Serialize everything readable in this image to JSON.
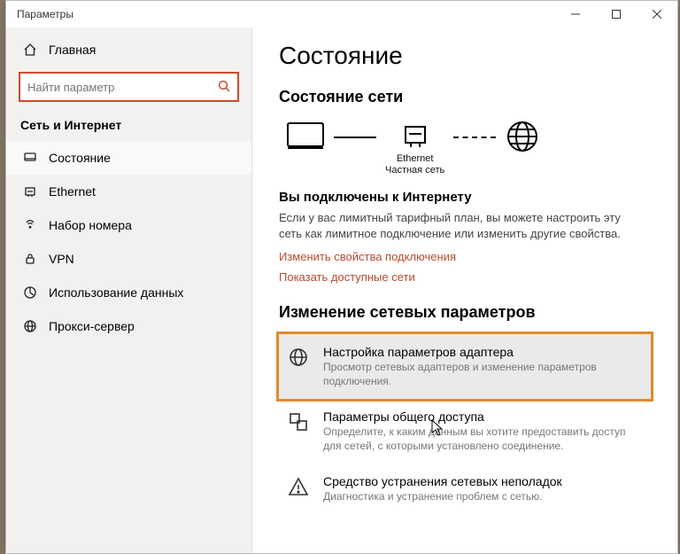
{
  "titlebar": {
    "title": "Параметры"
  },
  "sidebar": {
    "home": "Главная",
    "search_placeholder": "Найти параметр",
    "group": "Сеть и Интернет",
    "items": [
      {
        "label": "Состояние"
      },
      {
        "label": "Ethernet"
      },
      {
        "label": "Набор номера"
      },
      {
        "label": "VPN"
      },
      {
        "label": "Использование данных"
      },
      {
        "label": "Прокси-сервер"
      }
    ]
  },
  "main": {
    "heading": "Состояние",
    "net_status_title": "Состояние сети",
    "diagram": {
      "iface": "Ethernet",
      "iface_type": "Частная сеть"
    },
    "connected_title": "Вы подключены к Интернету",
    "connected_text": "Если у вас лимитный тарифный план, вы можете настроить эту сеть как лимитное подключение или изменить другие свойства.",
    "link_change_props": "Изменить свойства подключения",
    "link_show_nets": "Показать доступные сети",
    "change_params_title": "Изменение сетевых параметров",
    "options": [
      {
        "title": "Настройка параметров адаптера",
        "desc": "Просмотр сетевых адаптеров и изменение параметров подключения."
      },
      {
        "title": "Параметры общего доступа",
        "desc": "Определите, к каким данным вы хотите предоставить доступ для сетей, с которыми установлено соединение."
      },
      {
        "title": "Средство устранения сетевых неполадок",
        "desc": "Диагностика и устранение проблем с сетью."
      }
    ]
  }
}
